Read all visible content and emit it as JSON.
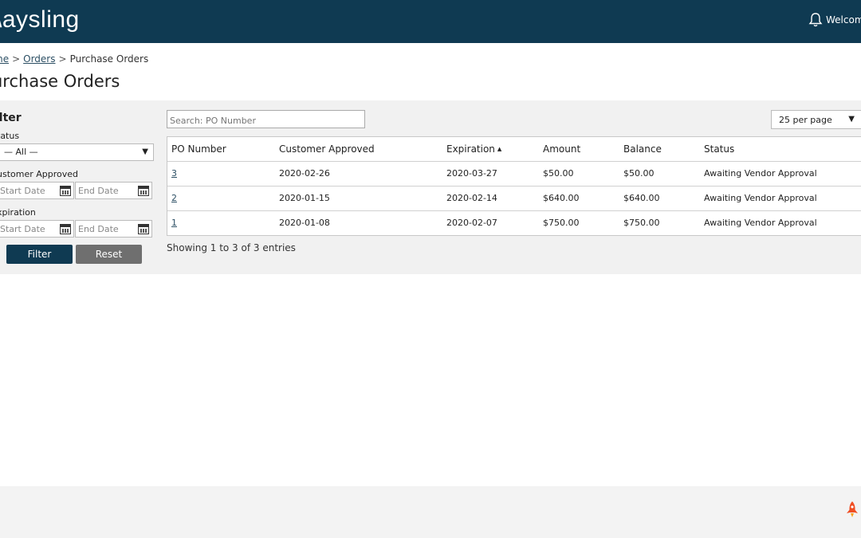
{
  "header": {
    "logo_text": "aysling",
    "welcome_text": "Welcome"
  },
  "breadcrumb": {
    "home": "me",
    "orders": "Orders",
    "current": "Purchase Orders",
    "separator": ">"
  },
  "page": {
    "title": "urchase Orders"
  },
  "filter": {
    "title": "ilter",
    "status_label": "tatus",
    "status_value": "— All —",
    "customer_approved_label": "ustomer Approved",
    "expiration_label": "xpiration",
    "start_date_placeholder": "Start Date",
    "end_date_placeholder": "End Date",
    "filter_button": "Filter",
    "reset_button": "Reset"
  },
  "search": {
    "placeholder": "Search: PO Number"
  },
  "per_page": {
    "value": "25 per page"
  },
  "table": {
    "columns": [
      "PO Number",
      "Customer Approved",
      "Expiration",
      "Amount",
      "Balance",
      "Status"
    ],
    "sort_indicator": "▲",
    "rows": [
      [
        "3",
        "2020-02-26",
        "2020-03-27",
        "$50.00",
        "$50.00",
        "Awaiting Vendor Approval"
      ],
      [
        "2",
        "2020-01-15",
        "2020-02-14",
        "$640.00",
        "$640.00",
        "Awaiting Vendor Approval"
      ],
      [
        "1",
        "2020-01-08",
        "2020-02-07",
        "$750.00",
        "$750.00",
        "Awaiting Vendor Approval"
      ]
    ],
    "entries_text": "Showing 1 to 3 of 3 entries"
  },
  "colors": {
    "header_bg": "#0f3a52",
    "panel_bg": "#f1f1f1",
    "reset_button_bg": "#6f6f6f",
    "link": "#2c4f64",
    "rocket": "#f04e23"
  },
  "icons": {
    "bell": "bell-icon",
    "calendar": "calendar-icon",
    "rocket": "rocket-icon",
    "dropdown": "chevron-down-icon"
  }
}
